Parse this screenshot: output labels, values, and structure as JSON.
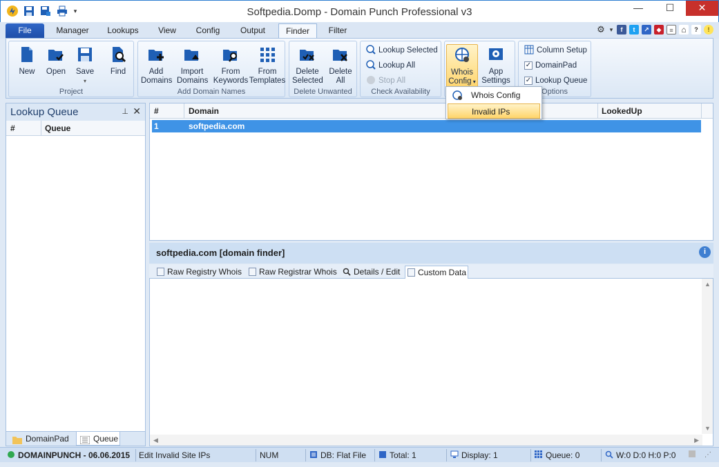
{
  "window": {
    "title": "Softpedia.Domp - Domain Punch Professional v3",
    "minimize": "—",
    "maximize": "☐",
    "close": "✕"
  },
  "tabs": {
    "file": "File",
    "manager": "Manager",
    "lookups": "Lookups",
    "view": "View",
    "config": "Config",
    "output": "Output",
    "finder": "Finder",
    "filter": "Filter"
  },
  "ribbon": {
    "project": {
      "label": "Project",
      "new": "New",
      "open": "Open",
      "save": "Save",
      "find": "Find"
    },
    "add_domain_names": {
      "label": "Add Domain Names",
      "add_domains": [
        "Add",
        "Domains"
      ],
      "import_domains": [
        "Import",
        "Domains"
      ],
      "from_keywords": [
        "From",
        "Keywords"
      ],
      "from_templates": [
        "From",
        "Templates"
      ]
    },
    "delete_unwanted": {
      "label": "Delete Unwanted",
      "delete_selected": [
        "Delete",
        "Selected"
      ],
      "delete_all": [
        "Delete",
        "All"
      ]
    },
    "check_availability": {
      "label": "Check Availability",
      "lookup_selected": "Lookup Selected",
      "lookup_all": "Lookup All",
      "stop_all": "Stop All"
    },
    "whois": {
      "whois_config": [
        "Whois",
        "Config"
      ],
      "app_settings": [
        "App",
        "Settings"
      ]
    },
    "options": {
      "label": "Options",
      "column_setup": "Column Setup",
      "domainpad": "DomainPad",
      "lookup_queue": "Lookup Queue"
    }
  },
  "dropdown": {
    "whois_config": "Whois Config",
    "invalid_ips": "Invalid IPs"
  },
  "left_panel": {
    "title": "Lookup Queue",
    "col_num": "#",
    "col_queue": "Queue",
    "tab_domainpad": "DomainPad",
    "tab_queue": "Queue"
  },
  "grid": {
    "col_num": "#",
    "col_domain": "Domain",
    "col_lookedup": "LookedUp",
    "rows": [
      {
        "num": "1",
        "domain": "softpedia.com"
      }
    ]
  },
  "detail": {
    "title": "softpedia.com [domain finder]",
    "tabs": {
      "raw_registry": "Raw Registry Whois",
      "raw_registrar": "Raw Registrar Whois",
      "details": "Details / Edit",
      "custom": "Custom Data"
    }
  },
  "statusbar": {
    "app": "DOMAINPUNCH - 06.06.2015",
    "action": "Edit Invalid Site IPs",
    "num": "NUM",
    "db": "DB: Flat File",
    "total": "Total: 1",
    "display": "Display: 1",
    "queue": "Queue: 0",
    "stats": "W:0 D:0 H:0 P:0"
  },
  "colors": {
    "accent": "#2f66c6",
    "selection": "#3f93e6",
    "menu_highlight": "#ffd56b"
  }
}
